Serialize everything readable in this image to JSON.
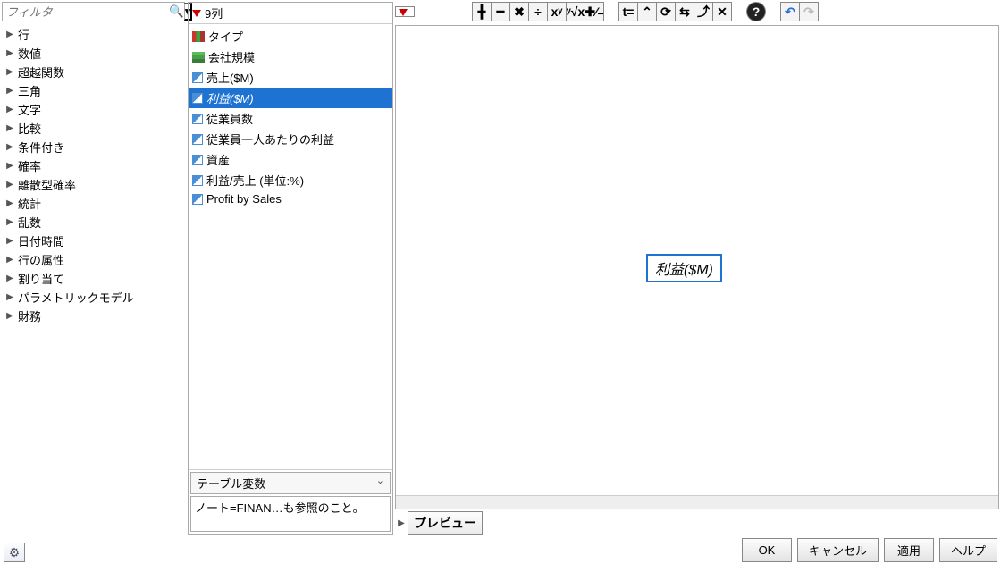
{
  "filter": {
    "placeholder": "フィルタ"
  },
  "categories": [
    "行",
    "数値",
    "超越関数",
    "三角",
    "文字",
    "比較",
    "条件付き",
    "確率",
    "離散型確率",
    "統計",
    "乱数",
    "日付時間",
    "行の属性",
    "割り当て",
    "パラメトリックモデル",
    "財務"
  ],
  "columnsHeader": "9列",
  "columns": [
    {
      "label": "タイプ",
      "iconType": "nominal",
      "selected": false
    },
    {
      "label": "会社規模",
      "iconType": "ordinal",
      "selected": false
    },
    {
      "label": "売上($M)",
      "iconType": "continuous",
      "selected": false
    },
    {
      "label": "利益($M)",
      "iconType": "continuous",
      "selected": true
    },
    {
      "label": "従業員数",
      "iconType": "continuous",
      "selected": false
    },
    {
      "label": "従業員一人あたりの利益",
      "iconType": "continuous",
      "selected": false
    },
    {
      "label": "資産",
      "iconType": "continuous",
      "selected": false
    },
    {
      "label": "利益/売上 (単位:%)",
      "iconType": "continuous",
      "selected": false
    },
    {
      "label": "Profit by Sales",
      "iconType": "continuous",
      "selected": false
    }
  ],
  "tableVar": "テーブル変数",
  "note": "ノート=FINAN…も参照のこと。",
  "formulaToken": "利益($M)",
  "preview": "プレビュー",
  "toolbar": {
    "add": "╋",
    "sub": "━",
    "mul": "✖",
    "div": "÷",
    "pow": "xʸ",
    "root": "ʸ√x",
    "pm": "✚⁄₋",
    "paren": "t=",
    "peek": "⌃",
    "rotl": "⟳",
    "swap": "⇆",
    "rotl2": "⤴",
    "del": "✕",
    "help": "?",
    "undo": "↶",
    "redo": "↷"
  },
  "buttons": {
    "ok": "OK",
    "cancel": "キャンセル",
    "apply": "適用",
    "help": "ヘルプ"
  }
}
